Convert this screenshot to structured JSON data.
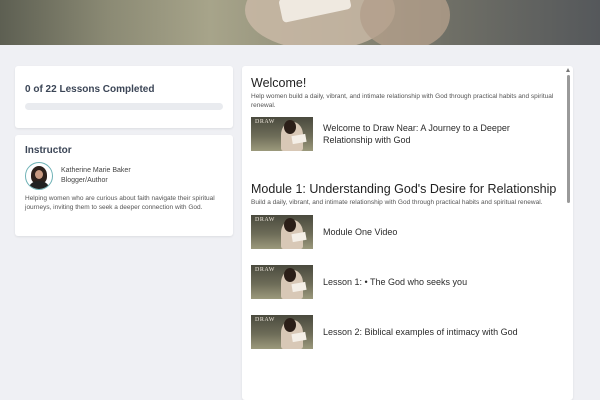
{
  "progress": {
    "title": "0 of 22 Lessons Completed",
    "completed_fraction": 0
  },
  "instructor": {
    "heading": "Instructor",
    "name": "Katherine Marie Baker",
    "role": "Blogger/Author",
    "bio": "Helping women who are curious about faith navigate their spiritual journeys, inviting them to seek a deeper connection with God."
  },
  "thumbnail": {
    "text": "DRAW"
  },
  "sections": [
    {
      "title": "Welcome!",
      "description": "Help women build a daily, vibrant, and intimate relationship with God through practical habits and spiritual renewal.",
      "lessons": [
        {
          "label": "Welcome to Draw Near: A Journey to a Deeper Relationship with God"
        }
      ]
    },
    {
      "title": "Module 1: Understanding God's Desire for Relationship",
      "description": "Build a daily, vibrant, and intimate relationship with God through practical habits and spiritual renewal.",
      "lessons": [
        {
          "label": "Module One Video"
        },
        {
          "label": "Lesson 1: • The God who seeks you"
        },
        {
          "label": "Lesson 2: Biblical examples of intimacy with God"
        }
      ]
    }
  ],
  "colors": {
    "accent": "#3d7bd9",
    "avatar_border": "#6fb2b6",
    "background": "#eff0f4"
  },
  "icons": {
    "scroll_up": "scroll-up-arrow-icon"
  }
}
